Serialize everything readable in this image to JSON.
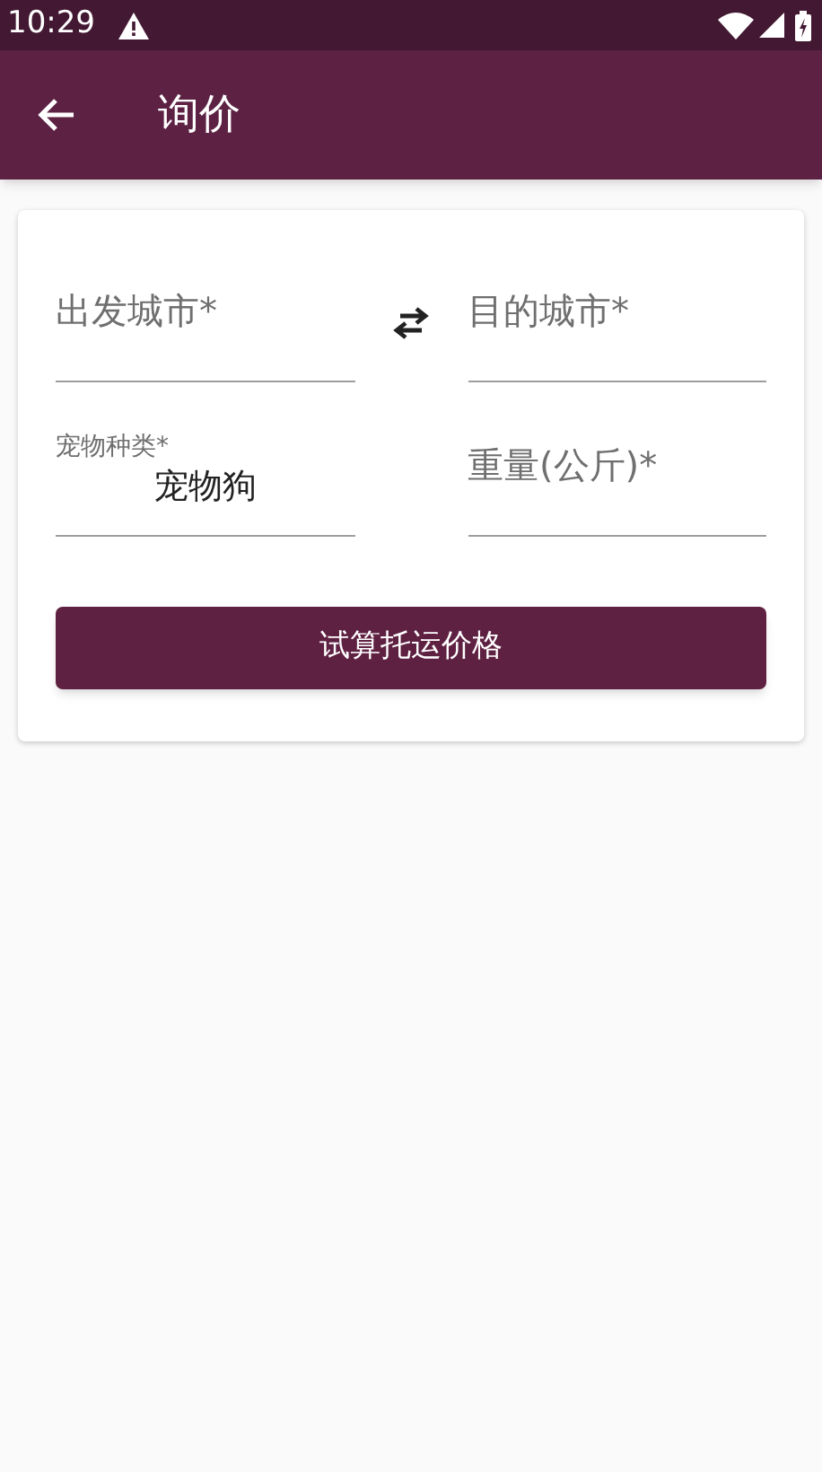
{
  "status_bar": {
    "time": "10:29"
  },
  "app_bar": {
    "title": "询价"
  },
  "form": {
    "rows": [
      {
        "left": {
          "kind": "empty",
          "placeholder": "出发城市*"
        },
        "swap": true,
        "right": {
          "kind": "empty",
          "placeholder": "目的城市*"
        }
      },
      {
        "left": {
          "kind": "filled",
          "label": "宠物种类*",
          "value": "宠物狗"
        },
        "swap": false,
        "right": {
          "kind": "empty",
          "placeholder": "重量(公斤)*"
        }
      }
    ],
    "button": "试算托运价格"
  }
}
